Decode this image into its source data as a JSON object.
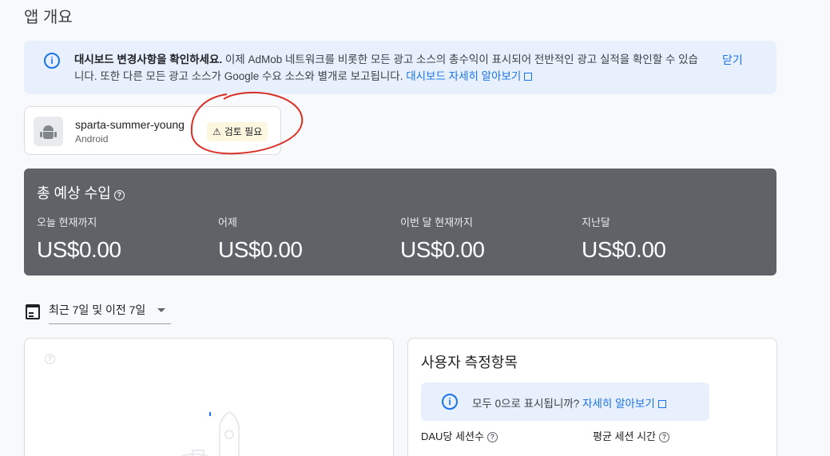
{
  "page": {
    "title": "앱 개요"
  },
  "banner": {
    "bold_text": "대시보드 변경사항을 확인하세요.",
    "text": " 이제 AdMob 네트워크를 비롯한 모든 광고 소스의 총수익이 표시되어 전반적인 광고 실적을 확인할 수 있습니다. 또한 다른 모든 광고 소스가 Google 수요 소스와 별개로 보고됩니다. ",
    "link": "대시보드 자세히 알아보기",
    "close": "닫기"
  },
  "app": {
    "name": "sparta-summer-young",
    "platform": "Android",
    "badge": "검토 필요"
  },
  "revenue": {
    "title": "총 예상 수입",
    "metrics": [
      {
        "label": "오늘 현재까지",
        "value": "US$0.00"
      },
      {
        "label": "어제",
        "value": "US$0.00"
      },
      {
        "label": "이번 달 현재까지",
        "value": "US$0.00"
      },
      {
        "label": "지난달",
        "value": "US$0.00"
      }
    ]
  },
  "date_range": {
    "value": "최근 7일 및 이전 7일"
  },
  "user_metrics": {
    "title": "사용자 측정항목",
    "info_text": "모두 0으로 표시됩니까? ",
    "info_link": "자세히 알아보기",
    "dau_label": "DAU당 세션수",
    "avg_session_label": "평균 세션 시간"
  },
  "colors": {
    "accent": "#1a73e8",
    "revenue_bg": "#5f6368",
    "banner_bg": "#e8f0fe",
    "badge_bg": "#fef7e0",
    "annotation": "#d93025"
  }
}
